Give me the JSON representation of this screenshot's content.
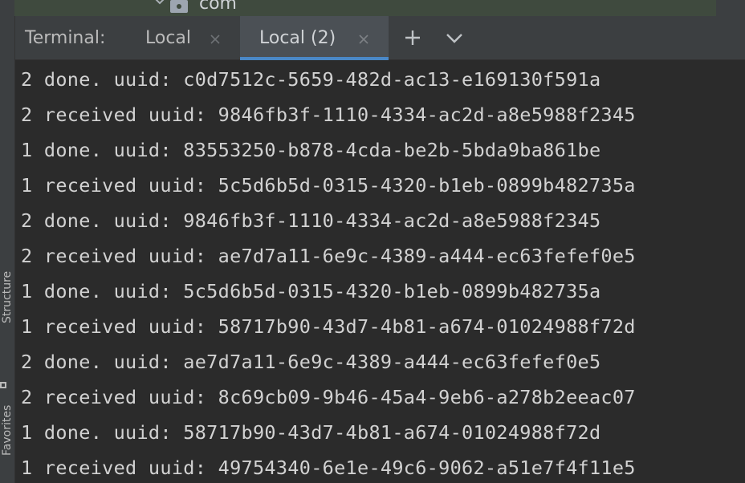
{
  "project_tree": {
    "package_label": "com"
  },
  "side_stripe": {
    "structure_label": "Structure",
    "favorites_label": "Favorites"
  },
  "terminal": {
    "title": "Terminal:",
    "tabs": [
      {
        "label": "Local",
        "active": false
      },
      {
        "label": "Local (2)",
        "active": true
      }
    ],
    "accent_color": "#4a88c7",
    "lines": [
      "2 done. uuid: c0d7512c-5659-482d-ac13-e169130f591a",
      "2 received uuid: 9846fb3f-1110-4334-ac2d-a8e5988f2345",
      "1 done. uuid: 83553250-b878-4cda-be2b-5bda9ba861be",
      "1 received uuid: 5c5d6b5d-0315-4320-b1eb-0899b482735a",
      "2 done. uuid: 9846fb3f-1110-4334-ac2d-a8e5988f2345",
      "2 received uuid: ae7d7a11-6e9c-4389-a444-ec63fefef0e5",
      "1 done. uuid: 5c5d6b5d-0315-4320-b1eb-0899b482735a",
      "1 received uuid: 58717b90-43d7-4b81-a674-01024988f72d",
      "2 done. uuid: ae7d7a11-6e9c-4389-a444-ec63fefef0e5",
      "2 received uuid: 8c69cb09-9b46-45a4-9eb6-a278b2eeac07",
      "1 done. uuid: 58717b90-43d7-4b81-a674-01024988f72d",
      "1 received uuid: 49754340-6e1e-49c6-9062-a51e7f4f11e5"
    ]
  }
}
